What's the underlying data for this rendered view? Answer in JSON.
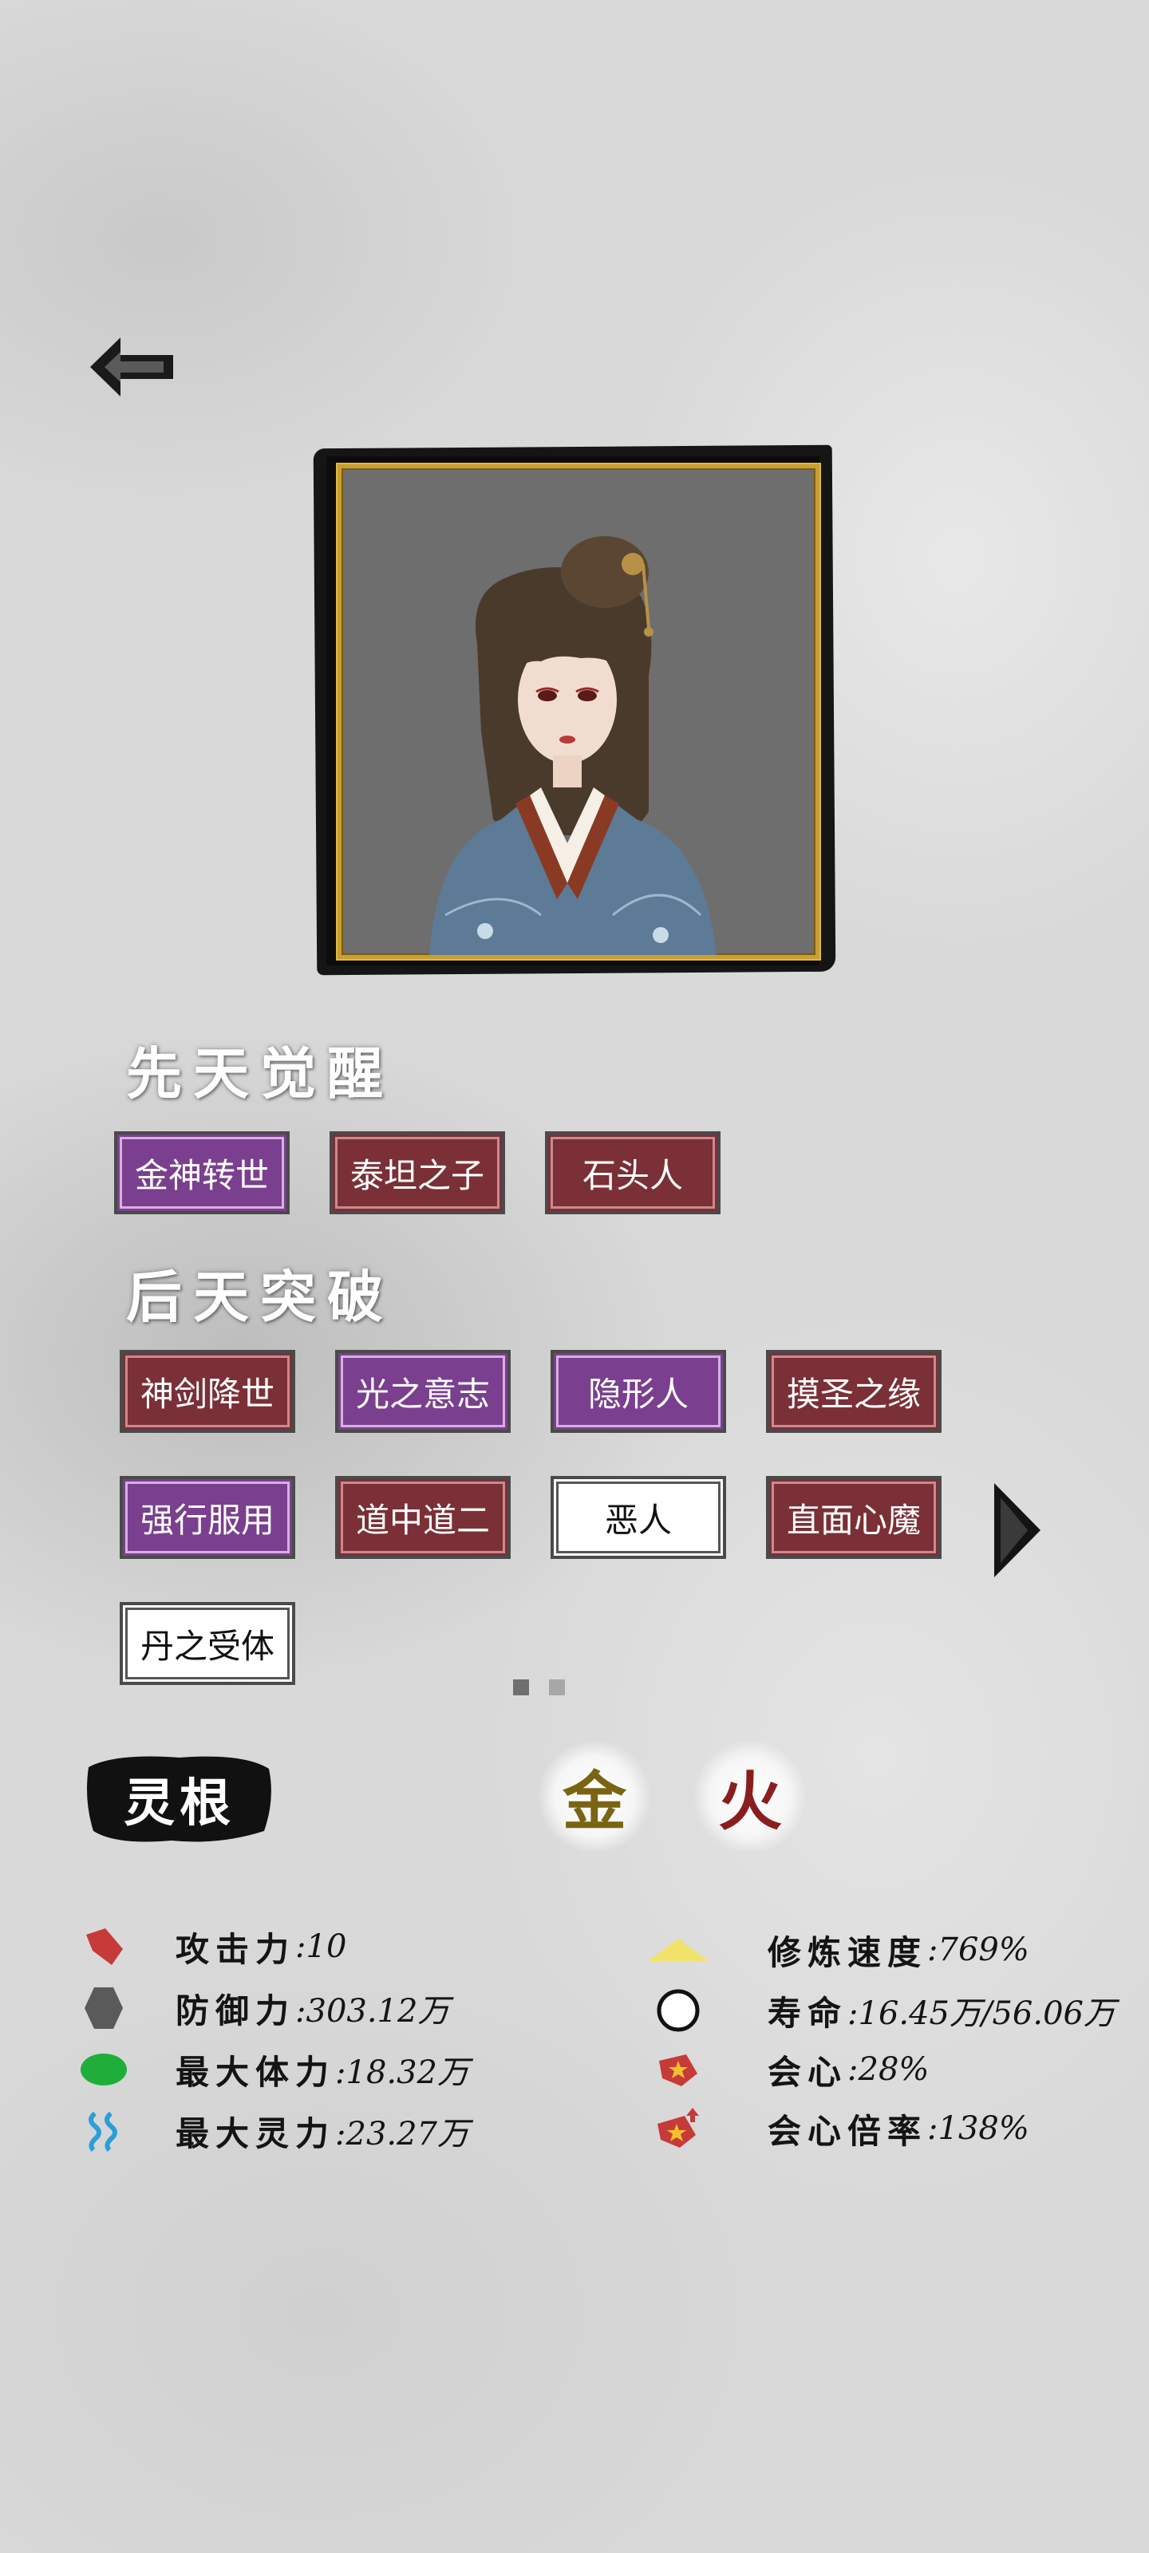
{
  "innate_section": {
    "title": "先天觉醒",
    "tags": [
      "金神转世",
      "泰坦之子",
      "石头人"
    ]
  },
  "acquired_section": {
    "title": "后天突破",
    "tags": [
      "神剑降世",
      "光之意志",
      "隐形人",
      "摸圣之缘",
      "强行服用",
      "道中道二",
      "恶人",
      "直面心魔",
      "丹之受体"
    ]
  },
  "spirit_root": {
    "label": "灵根",
    "elements": [
      "金",
      "火"
    ],
    "element_colors": [
      "#7a6414",
      "#8a1d1d"
    ]
  },
  "stats_left": [
    {
      "label": "攻击力",
      "value": ":10",
      "icon": "red-gem-icon"
    },
    {
      "label": "防御力",
      "value": ":303.12万",
      "icon": "gray-hexagon-icon"
    },
    {
      "label": "最大体力",
      "value": ":18.32万",
      "icon": "green-heart-icon"
    },
    {
      "label": "最大灵力",
      "value": ":23.27万",
      "icon": "blue-wave-icon"
    }
  ],
  "stats_right": [
    {
      "label": "修炼速度",
      "value": ":769%",
      "icon": "yellow-triangle-icon"
    },
    {
      "label": "寿命",
      "value": ":16.45万/56.06万",
      "icon": "circle-icon"
    },
    {
      "label": "会心",
      "value": ":28%",
      "icon": "crit-star-icon"
    },
    {
      "label": "会心倍率",
      "value": ":138%",
      "icon": "crit-multiplier-icon"
    }
  ],
  "colors": {
    "purple_tag": "#7a3f8e",
    "red_tag": "#7a3036",
    "gold_frame": "#c9a030"
  }
}
